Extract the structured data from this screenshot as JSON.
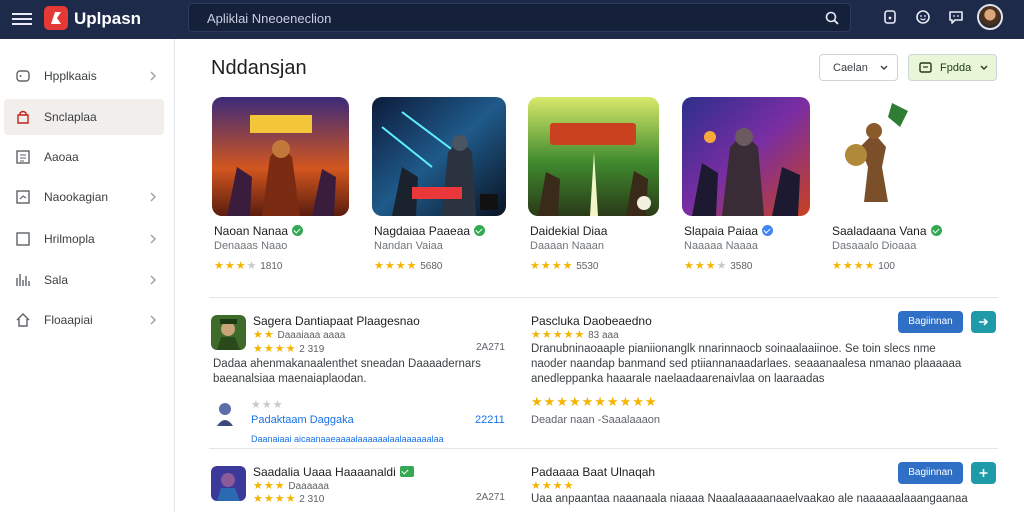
{
  "app": {
    "title": "Uplpasn",
    "search_placeholder": "Apliklai Nneoeneclion"
  },
  "colors": {
    "topbar": "#1e2a4a",
    "logo": "#e53935",
    "primary": "#2f6fc6",
    "teal": "#1f9aa8",
    "star": "#f4b400",
    "active_item_bg": "#f1eeec",
    "filter_green": "#e9f7d8"
  },
  "sidebar": {
    "items": [
      {
        "label": "Hpplkaais",
        "icon": "apps-icon",
        "chevron": true
      },
      {
        "label": "Snclaplaa",
        "icon": "store-icon",
        "chevron": false,
        "active": true
      },
      {
        "label": "Aaoaa",
        "icon": "list-icon",
        "chevron": false
      },
      {
        "label": "Naookagian",
        "icon": "chart-icon",
        "chevron": true
      },
      {
        "label": "Hrilmopla",
        "icon": "square-icon",
        "chevron": true
      },
      {
        "label": "Sala",
        "icon": "trend-icon",
        "chevron": true
      },
      {
        "label": "Floaapiai",
        "icon": "home-icon",
        "chevron": true
      }
    ]
  },
  "main": {
    "title": "Nddansjan",
    "filter_sort": "Caelan",
    "filter_type": "Fpdda"
  },
  "cards": [
    {
      "title": "Naoan Nanaa",
      "sub": "Denaaas Naao",
      "stars": 3,
      "rating": "1810",
      "verified_color": "#34a853",
      "theme": "fire"
    },
    {
      "title": "Nagdaiaa Paaeaa",
      "sub": "Nandan Vaiaa",
      "stars": 4,
      "rating": "5680",
      "verified_color": "#34a853",
      "theme": "blue"
    },
    {
      "title": "Daidekial Diaa",
      "sub": "Daaaan Naaan",
      "stars": 4,
      "rating": "5530",
      "verified_color": null,
      "theme": "green"
    },
    {
      "title": "Slapaia Paiaa",
      "sub": "Naaaaa Naaaa",
      "stars": 3,
      "rating": "3580",
      "verified_color": "#4285f4",
      "theme": "purple"
    },
    {
      "title": "Saaladaana Vana",
      "sub": "Dasaaalo Dioaaa",
      "stars": 4,
      "rating": "100",
      "verified_color": "#34a853",
      "theme": "plain"
    }
  ],
  "list": [
    {
      "title": "Sagera Dantiapaat Plaagesnao",
      "meta1": "Daaaiaaa aaaa",
      "stars": 4,
      "count": "2 319",
      "count_right": "2A271",
      "desc": "Dadaa ahenmakanaalenthet sneadan Daaaadernars baeanalsiaa maenaiaplaodan.",
      "sub_stars": 2,
      "sub_link": "Padaktaam Daggaka",
      "sub_num": "22211",
      "sub_link_small": "Daanaiaai aicaanaaeaaaalaaaaaalaalaaaaaalaa",
      "right_title": "Pascluka Daobeaedno",
      "right_meta": "83 aaa",
      "right_stars": 5,
      "right_desc": "Dranubninaoaaple pianiionanglk nnarinnaocb soinaalaaiinoe. Se toin slecs nme naoder naandap banmand sed ptiiannanaadarlaes. seaaanaalesa nmanao plaaaaaa anedleppanka haaarale naelaadaarenaivlaa on laaraadas",
      "right_big_stars": 10,
      "right_footer": "Deadar naan  -Saaalaaaon",
      "btn_label": "Bagiinnan"
    },
    {
      "title": "Saadalia Uaaa Haaaanaldi",
      "meta1": "Daaaaaa",
      "stars": 4,
      "count": "2 310",
      "count_right": "2A271",
      "desc": "",
      "right_title": "Padaaaa Baat Ulnaqah",
      "right_meta": "",
      "right_stars": 4,
      "right_desc": "Uaa anpaantaa naaanaala niaaaa Naaalaaaaanaaelvaakao ale naaaaaalaaangaanaa aaalaar",
      "btn_label": "Bagiinnan"
    }
  ]
}
